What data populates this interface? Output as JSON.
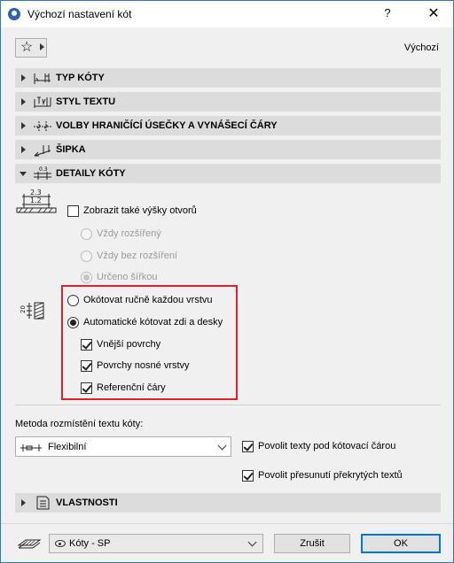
{
  "window": {
    "title": "Výchozí nastavení kót"
  },
  "titlebar": {
    "help": "?",
    "close": "✕"
  },
  "toolbar": {
    "favorites_icon": "star-icon",
    "default_label": "Výchozí"
  },
  "panels": [
    {
      "label": "TYP KÓTY",
      "expanded": false
    },
    {
      "label": "STYL TEXTU",
      "expanded": false
    },
    {
      "label": "VOLBY HRANIČÍCÍ ÚSEČKY A VYNÁŠECÍ ČÁRY",
      "expanded": false
    },
    {
      "label": "ŠIPKA",
      "expanded": false
    },
    {
      "label": "DETAILY KÓTY",
      "expanded": true
    }
  ],
  "details": {
    "icon_top_value": "2.3",
    "icon_bottom_value": "1.2",
    "show_openings_label": "Zobrazit také výšky otvorů",
    "show_openings_checked": false,
    "opening_options": [
      {
        "label": "Vždy rozšířený",
        "selected": false
      },
      {
        "label": "Vždy bez rozšíření",
        "selected": false
      },
      {
        "label": "Určeno šířkou",
        "selected": true
      }
    ],
    "layer_icon_value": "20",
    "layer_options": [
      {
        "label": "Okótovat ručně každou vrstvu",
        "selected": false
      },
      {
        "label": "Automatické kótovat zdi a desky",
        "selected": true
      }
    ],
    "sub_checks": [
      {
        "label": "Vnější povrchy",
        "checked": true
      },
      {
        "label": "Povrchy nosné vrstvy",
        "checked": true
      },
      {
        "label": "Referenční čáry",
        "checked": true
      }
    ],
    "placement_label": "Metoda rozmístění textu kóty:",
    "placement_value": "Flexibilní",
    "allow_under_label": "Povolit texty pod kótovací čárou",
    "allow_under_checked": true,
    "allow_move_label": "Povolit přesunutí překrytých textů",
    "allow_move_checked": true
  },
  "properties_panel": {
    "label": "VLASTNOSTI",
    "expanded": false
  },
  "footer": {
    "layer_value": "Kóty - SP",
    "cancel_label": "Zrušit",
    "ok_label": "OK"
  },
  "colors": {
    "highlight_frame": "#e0202a",
    "panel_header": "#dcdcdc",
    "ok_border": "#0078d7"
  }
}
